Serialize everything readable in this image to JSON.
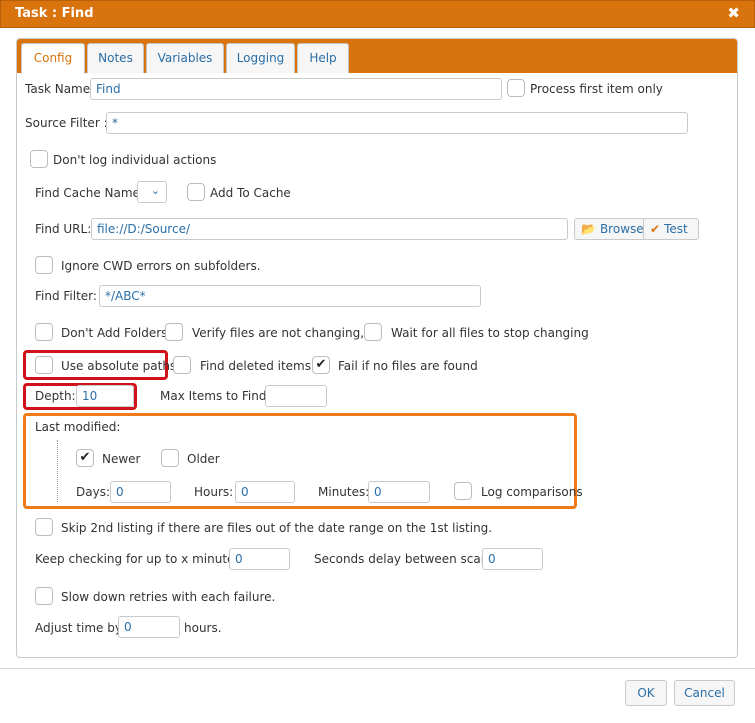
{
  "dialog": {
    "title": "Task : Find",
    "close_icon": "close-icon"
  },
  "tabs": [
    {
      "label": "Config",
      "active": true
    },
    {
      "label": "Notes"
    },
    {
      "label": "Variables"
    },
    {
      "label": "Logging"
    },
    {
      "label": "Help"
    }
  ],
  "form": {
    "task_name_label": "Task Name:",
    "task_name_value": "Find",
    "process_first_label": "Process first item only",
    "process_first_checked": false,
    "source_filter_label": "Source Filter :",
    "source_filter_value": "*",
    "dont_log_label": "Don't log individual actions",
    "find_cache_name_label": "Find Cache Name:",
    "add_to_cache_label": "Add To Cache",
    "find_url_label": "Find URL:",
    "find_url_value": "file://D:/Source/",
    "browse_label": "Browse",
    "test_label": "Test",
    "ignore_cwd_label": "Ignore CWD errors on subfolders.",
    "find_filter_label": "Find Filter:",
    "find_filter_value": "*/ABC*",
    "dont_add_folders_label": "Don't Add Folders",
    "verify_files_label": "Verify files are not changing,",
    "wait_files_label": "Wait for all files to stop changing",
    "use_absolute_label": "Use absolute paths",
    "find_deleted_label": "Find deleted items",
    "fail_if_none_label": "Fail if no files are found",
    "fail_if_none_checked": true,
    "depth_label": "Depth:",
    "depth_value": "10",
    "max_items_label": "Max Items to Find:",
    "max_items_value": "",
    "last_modified_label": "Last modified:",
    "newer_label": "Newer",
    "newer_checked": true,
    "older_label": "Older",
    "days_label": "Days:",
    "days_value": "0",
    "hours_label": "Hours:",
    "hours_value": "0",
    "minutes_label": "Minutes:",
    "minutes_value": "0",
    "log_comparisons_label": "Log comparisons",
    "skip_2nd_label": "Skip 2nd listing if there are files out of the date range on the 1st listing.",
    "keep_checking_label": "Keep checking for up to x minutes:",
    "keep_checking_value": "0",
    "seconds_delay_label": "Seconds delay between scans:",
    "seconds_delay_value": "0",
    "slow_down_label": "Slow down retries with each failure.",
    "adjust_time_label": "Adjust time by",
    "adjust_time_value": "0",
    "hours_suffix": "hours."
  },
  "footer": {
    "ok_label": "OK",
    "cancel_label": "Cancel"
  },
  "colors": {
    "accent": "#d9730d",
    "link": "#2a6fa8",
    "highlight_red": "#d0121b",
    "highlight_orange": "#ef7a1a"
  }
}
